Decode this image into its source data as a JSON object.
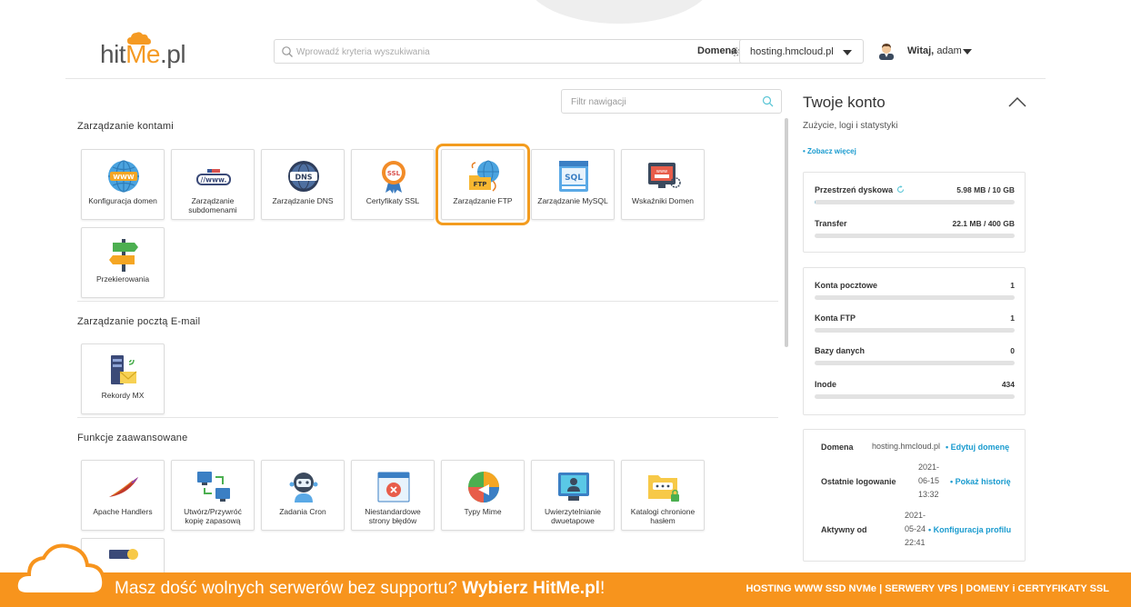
{
  "header": {
    "logo_text_a": "hit",
    "logo_text_b": "Me",
    "logo_text_c": ".pl",
    "search_placeholder": "Wprowadź kryteria wyszukiwania",
    "domain_label": "Domena",
    "domain_value": "hosting.hmcloud.pl",
    "greeting_bold": "Witaj,",
    "greeting_user": "adam"
  },
  "nav_filter": {
    "placeholder": "Filtr nawigacji"
  },
  "sections": {
    "accounts": {
      "title": "Zarządzanie kontami",
      "tiles": [
        {
          "label": "Konfiguracja domen",
          "icon": "globe-www-icon"
        },
        {
          "label": "Zarządzanie subdomenami",
          "icon": "subdomain-www-icon"
        },
        {
          "label": "Zarządzanie DNS",
          "icon": "dns-globe-icon"
        },
        {
          "label": "Certyfikaty SSL",
          "icon": "ssl-badge-icon"
        },
        {
          "label": "Zarządzanie FTP",
          "icon": "ftp-folder-icon"
        },
        {
          "label": "Zarządzanie MySQL",
          "icon": "mysql-database-icon"
        },
        {
          "label": "Wskaźniki Domen",
          "icon": "domain-pointer-icon"
        },
        {
          "label": "Przekierowania",
          "icon": "signpost-icon"
        }
      ]
    },
    "email": {
      "title": "Zarządzanie pocztą E-mail",
      "tiles": [
        {
          "label": "Rekordy MX",
          "icon": "mx-server-mail-icon"
        }
      ]
    },
    "advanced": {
      "title": "Funkcje zaawansowane",
      "tiles": [
        {
          "label": "Apache Handlers",
          "icon": "apache-feather-icon"
        },
        {
          "label": "Utwórz/Przywróć kopię zapasową",
          "icon": "backup-computers-icon"
        },
        {
          "label": "Zadania Cron",
          "icon": "cron-robot-icon"
        },
        {
          "label": "Niestandardowe strony błędów",
          "icon": "error-page-icon"
        },
        {
          "label": "Typy Mime",
          "icon": "mime-types-icon"
        },
        {
          "label": "Uwierzytelnianie dwuetapowe",
          "icon": "two-factor-monitor-icon"
        },
        {
          "label": "Katalogi chronione hasłem",
          "icon": "password-folder-icon"
        }
      ]
    }
  },
  "account": {
    "title": "Twoje konto",
    "subtitle": "Zużycie, logi i statystyki",
    "see_more": "• Zobacz więcej",
    "usage": [
      {
        "label": "Przestrzeń dyskowa",
        "value": "5.98 MB / 10 GB",
        "fraction": 0.0006
      },
      {
        "label": "Transfer",
        "value": "22.1 MB / 400 GB",
        "fraction": 0.0001
      }
    ],
    "counts": [
      {
        "label": "Konta pocztowe",
        "value": "1"
      },
      {
        "label": "Konta FTP",
        "value": "1"
      },
      {
        "label": "Bazy danych",
        "value": "0"
      },
      {
        "label": "Inode",
        "value": "434"
      }
    ],
    "info": {
      "domain_label": "Domena",
      "domain_value": "hosting.hmcloud.pl",
      "domain_link": "• Edytuj domenę",
      "last_login_label": "Ostatnie logowanie",
      "last_login_value": [
        "2021-",
        "06-15",
        "13:32"
      ],
      "last_login_link": "• Pokaż historię",
      "active_label": "Aktywny od",
      "active_value": [
        "2021-",
        "05-24",
        "22:41"
      ],
      "active_link": "• Konfiguracja profilu"
    }
  },
  "banner": {
    "text_a": "Masz dość wolnych serwerów bez supportu?",
    "text_b": "Wybierz HitMe.pl",
    "text_c": "!",
    "right": "HOSTING WWW SSD NVMe | SERWERY VPS | DOMENY i CERTYFIKATY SSL"
  },
  "colors": {
    "accent": "#f7941d",
    "link": "#1a9bcf",
    "active_outline": "#f39c1f"
  }
}
